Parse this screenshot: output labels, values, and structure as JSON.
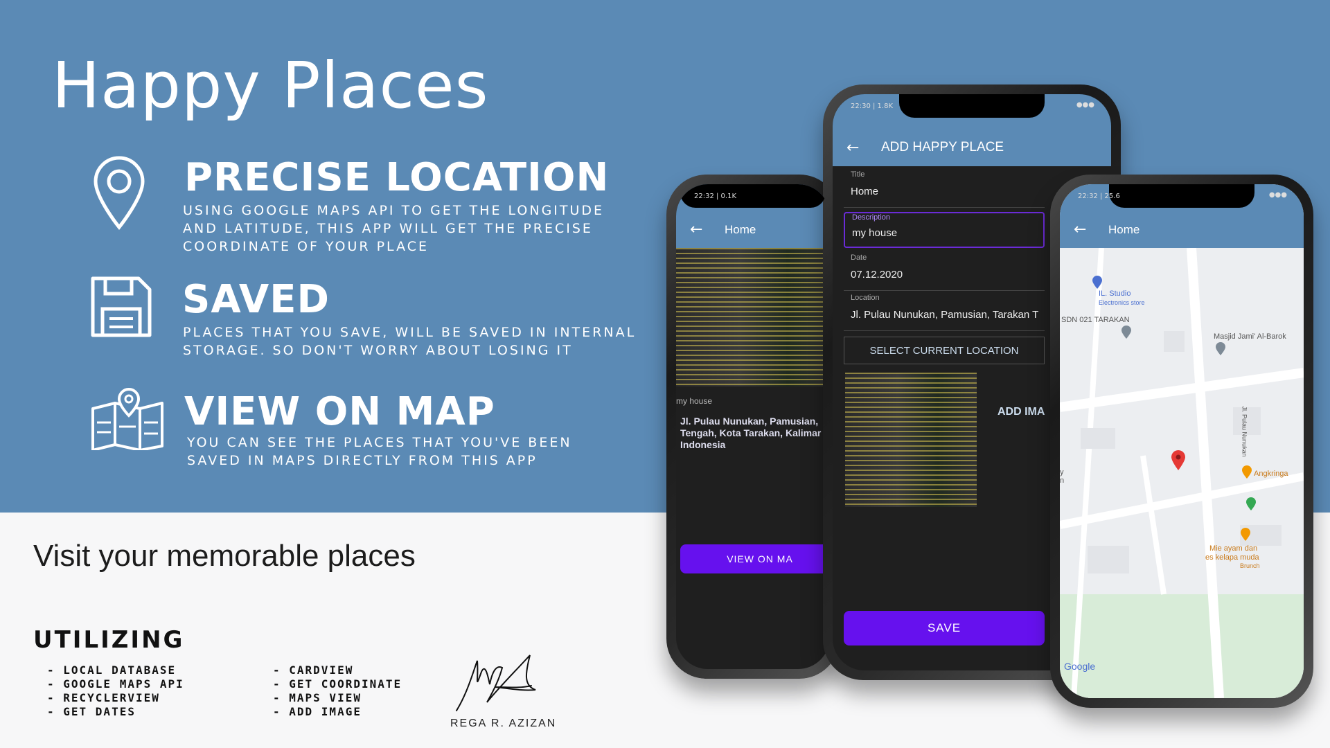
{
  "title": "Happy Places",
  "features": [
    {
      "heading": "PRECISE LOCATION",
      "icon": "map-pin-icon",
      "text": "USING GOOGLE MAPS API TO GET THE LONGITUDE\nAND LATITUDE, THIS APP WILL GET THE PRECISE\nCOORDINATE OF YOUR PLACE"
    },
    {
      "heading": "SAVED",
      "icon": "floppy-disk-icon",
      "text": "PLACES THAT YOU SAVE, WILL BE SAVED IN INTERNAL\nSTORAGE. SO DON'T WORRY ABOUT LOSING IT"
    },
    {
      "heading": "VIEW ON MAP",
      "icon": "folded-map-icon",
      "text": "YOU CAN  SEE THE PLACES THAT YOU'VE BEEN\nSAVED IN MAPS DIRECTLY FROM THIS APP"
    }
  ],
  "tagline": "Visit your memorable places",
  "utilizing": {
    "title": "UTILIZING",
    "col1": [
      "LOCAL DATABASE",
      "GOOGLE MAPS API",
      "RECYCLERVIEW",
      "GET DATES"
    ],
    "col2": [
      "CARDVIEW",
      "GET COORDINATE",
      "MAPS VIEW",
      "ADD IMAGE"
    ]
  },
  "author": "REGA R. AZIZAN",
  "colors": {
    "hero": "#5b8ab5",
    "accent": "#6611ee",
    "background": "#f7f7f8"
  },
  "phone_left": {
    "status": "22:32 | 0.1K",
    "appbar_title": "Home",
    "description": "my house",
    "address": "Jl. Pulau Nunukan, Pamusian,\nTengah, Kota Tarakan, Kalimar\nIndonesia",
    "button": "VIEW ON MA"
  },
  "phone_center": {
    "status": "22:30 | 1.8K",
    "appbar_title": "ADD HAPPY PLACE",
    "title_label": "Title",
    "title_value": "Home",
    "desc_label": "Description",
    "desc_value": "my house",
    "date_label": "Date",
    "date_value": "07.12.2020",
    "loc_label": "Location",
    "loc_value": "Jl. Pulau Nunukan, Pamusian, Tarakan T",
    "select_location": "SELECT CURRENT LOCATION",
    "add_image": "ADD IMA",
    "save": "SAVE"
  },
  "phone_right": {
    "status": "22:32 | 25.6",
    "appbar_title": "Home",
    "map_labels": {
      "studio": "IL. Studio",
      "studio_sub": "Electronics store",
      "school": "SDN 021 TARAKAN",
      "mosque": "Masjid Jami' Al-Barok",
      "road": "Jl. Pulau Nunukan",
      "angkringan": "Angkringa",
      "food1": "Mie ayam dan",
      "food2": "es kelapa muda",
      "food3": "Brunch",
      "side": "y\nn",
      "google": "Google"
    }
  }
}
